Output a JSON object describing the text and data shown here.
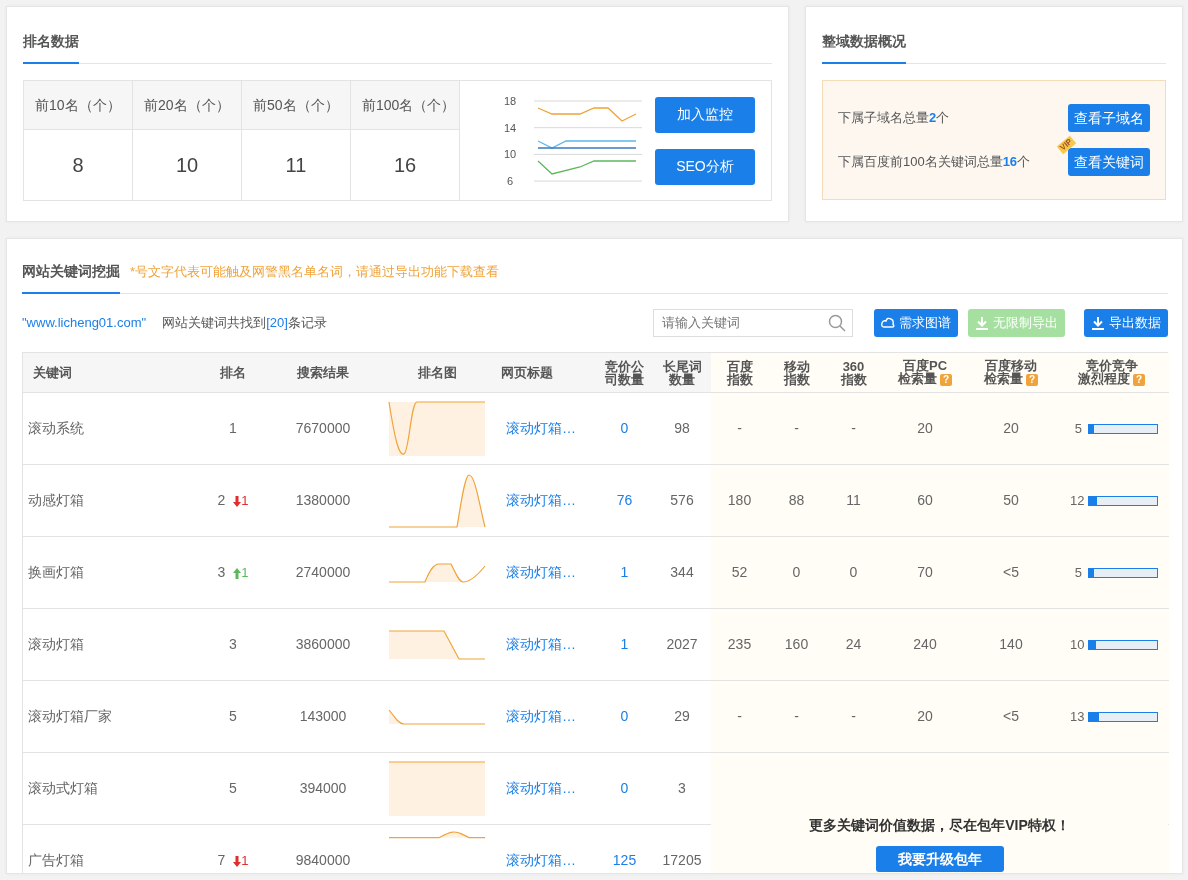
{
  "ranking": {
    "title": "排名数据",
    "stats": [
      {
        "label": "前10名（个）",
        "value": "8"
      },
      {
        "label": "前20名（个）",
        "value": "10"
      },
      {
        "label": "前50名（个）",
        "value": "11"
      },
      {
        "label": "前100名（个）",
        "value": "16"
      }
    ],
    "trend_axis_labels": [
      "18",
      "14",
      "10",
      "6"
    ],
    "buttons": [
      "加入监控",
      "SEO分析"
    ]
  },
  "domain_overview": {
    "title": "整域数据概况",
    "rows": [
      {
        "text": "下属子域名总量**2**个",
        "button": "查看子域名"
      },
      {
        "text": "下属百度前100名关键词总量**16**个",
        "button": "查看关键词",
        "badge": "VIP"
      }
    ]
  },
  "keywords": {
    "title": "网站关键词挖掘",
    "notice": "*号文字代表可能触及网警黑名单名词，请通过导出功能下载查看",
    "domain": "\"www.licheng01.com\"",
    "summary": {
      "prefix": "网站关键词共找到",
      "count": "[20]",
      "suffix": "条记录"
    },
    "search": {
      "placeholder": "请输入关键词"
    },
    "buttons": [
      {
        "label": "需求图谱",
        "kind": "graph",
        "disabled": false
      },
      {
        "label": "无限制导出",
        "kind": "download",
        "disabled": true
      },
      {
        "label": "导出数据",
        "kind": "download",
        "disabled": false
      }
    ],
    "columns": [
      {
        "lines": [
          "关键词"
        ]
      },
      {
        "lines": [
          "排名"
        ]
      },
      {
        "lines": [
          "搜索结果"
        ]
      },
      {
        "lines": [
          "排名图"
        ]
      },
      {
        "lines": [
          "网页标题"
        ]
      },
      {
        "lines": [
          "竞价公",
          "司数量"
        ]
      },
      {
        "lines": [
          "长尾词",
          "数量"
        ]
      },
      {
        "lines": [
          "百度",
          "指数"
        ]
      },
      {
        "lines": [
          "移动",
          "指数"
        ]
      },
      {
        "lines": [
          "360",
          "指数"
        ]
      },
      {
        "lines": [
          "百度PC",
          "检索量"
        ],
        "help": "?"
      },
      {
        "lines": [
          "百度移动",
          "检索量"
        ],
        "help": "?"
      },
      {
        "lines": [
          "竞价竞争",
          "激烈程度"
        ],
        "help": "?"
      }
    ],
    "rows": [
      {
        "keyword": "滚动系统",
        "rank": "1",
        "results": "7670000",
        "title": "滚动灯箱…",
        "bid_companies": "0",
        "longtail": "98",
        "baidu_index": "-",
        "mobile_index": "-",
        "index_360": "-",
        "pc_volume": "20",
        "mobile_volume": "20",
        "competition": "5",
        "level": 0.07
      },
      {
        "keyword": "动感灯箱",
        "rank": "2",
        "change": {
          "kind": "down",
          "value": "1"
        },
        "results": "1380000",
        "title": "滚动灯箱…",
        "bid_companies": "76",
        "longtail": "576",
        "baidu_index": "180",
        "mobile_index": "88",
        "index_360": "11",
        "pc_volume": "60",
        "mobile_volume": "50",
        "competition": "12",
        "level": 0.12
      },
      {
        "keyword": "换画灯箱",
        "rank": "3",
        "change": {
          "kind": "up",
          "value": "1"
        },
        "results": "2740000",
        "title": "滚动灯箱…",
        "bid_companies": "1",
        "longtail": "344",
        "baidu_index": "52",
        "mobile_index": "0",
        "index_360": "0",
        "pc_volume": "70",
        "mobile_volume": "<5",
        "competition": "5",
        "level": 0.07
      },
      {
        "keyword": "滚动灯箱",
        "rank": "3",
        "results": "3860000",
        "title": "滚动灯箱…",
        "bid_companies": "1",
        "longtail": "2027",
        "baidu_index": "235",
        "mobile_index": "160",
        "index_360": "24",
        "pc_volume": "240",
        "mobile_volume": "140",
        "competition": "10",
        "level": 0.11
      },
      {
        "keyword": "滚动灯箱厂家",
        "rank": "5",
        "results": "143000",
        "title": "滚动灯箱…",
        "bid_companies": "0",
        "longtail": "29",
        "baidu_index": "-",
        "mobile_index": "-",
        "index_360": "-",
        "pc_volume": "20",
        "mobile_volume": "<5",
        "competition": "13",
        "level": 0.14
      },
      {
        "keyword": "滚动式灯箱",
        "rank": "5",
        "results": "394000",
        "title": "滚动灯箱…",
        "bid_companies": "0",
        "longtail": "3"
      },
      {
        "keyword": "广告灯箱",
        "rank": "7",
        "change": {
          "kind": "down",
          "value": "1"
        },
        "results": "9840000",
        "title": "滚动灯箱…",
        "bid_companies": "125",
        "longtail": "17205"
      }
    ],
    "vip_overlay": {
      "message": "更多关键词价值数据，尽在包年VIP特权！",
      "button": "我要升级包年"
    }
  }
}
